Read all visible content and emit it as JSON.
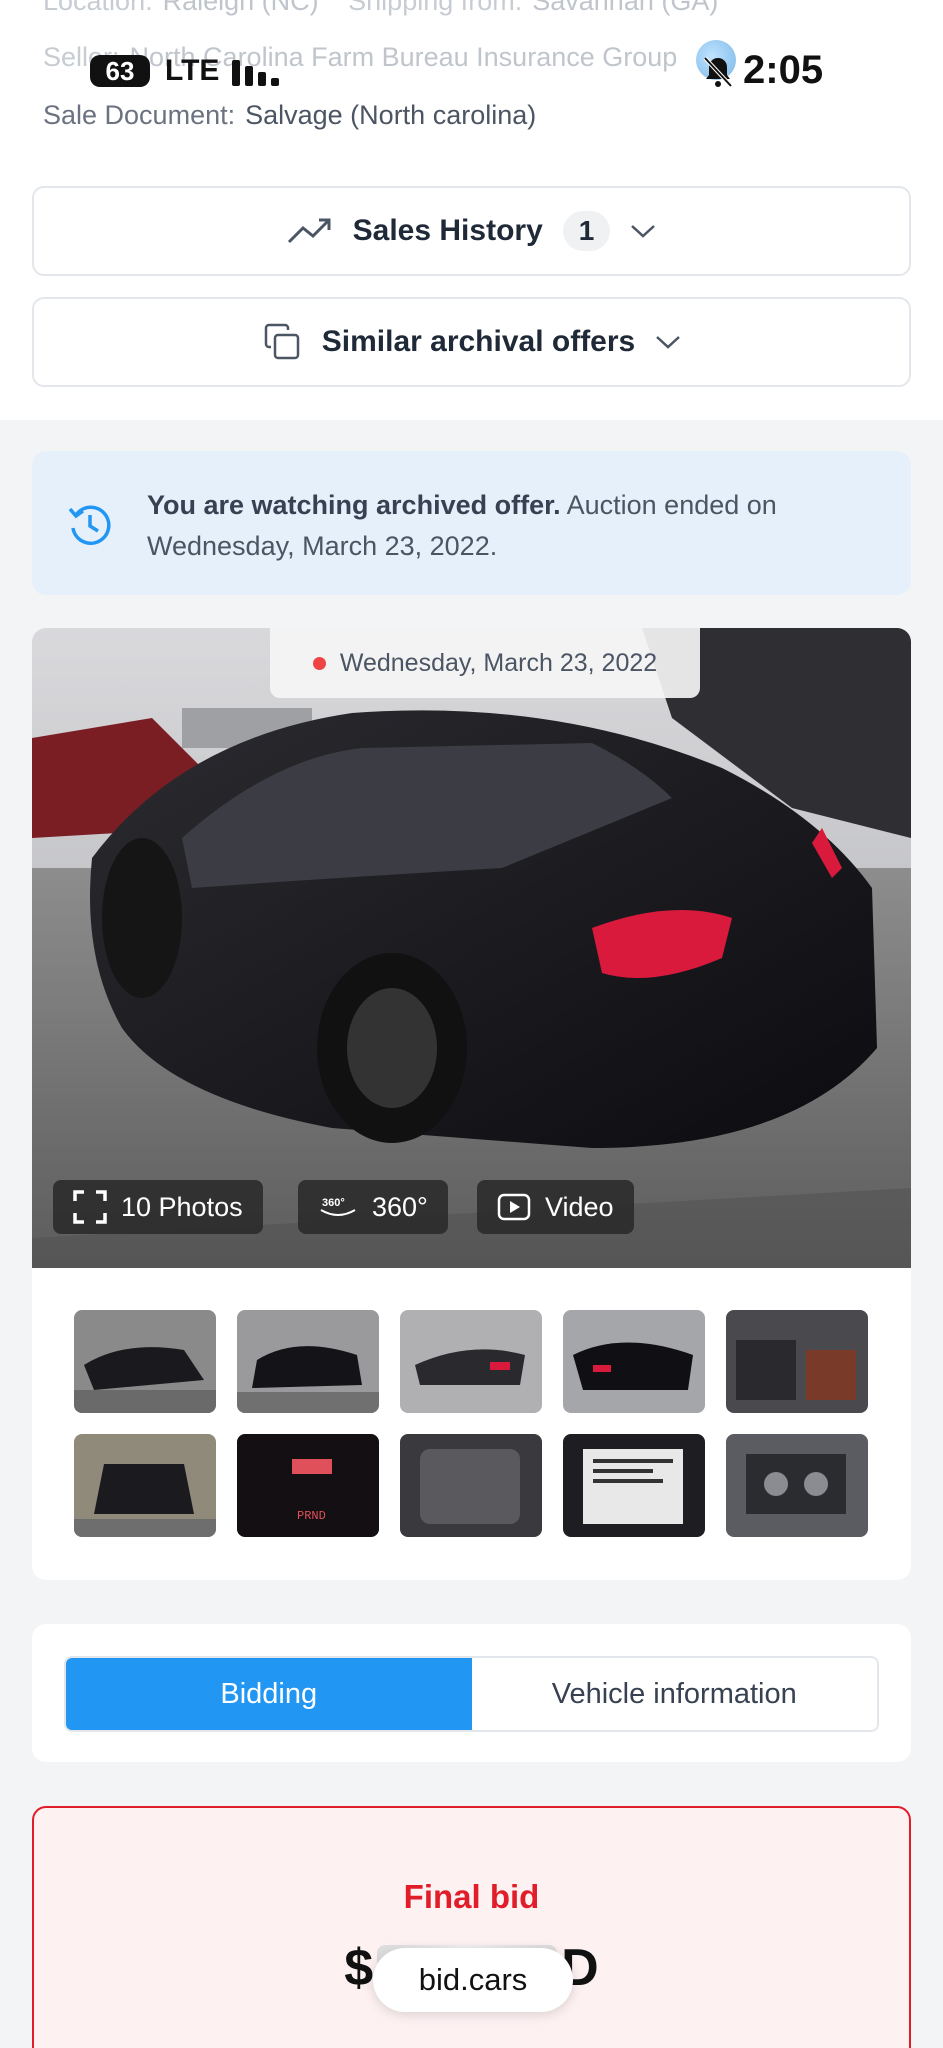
{
  "status_bar": {
    "badge": "63",
    "network": "LTE",
    "time": "2:05"
  },
  "meta": {
    "location_label": "Location:",
    "location_value": "Raleigh (NC)",
    "shipping_label": "Shipping from:",
    "shipping_value": "Savannah (GA)",
    "seller_label": "Seller:",
    "seller_value": "North Carolina Farm Bureau Insurance Group",
    "sale_doc_label": "Sale Document:",
    "sale_doc_value": "Salvage (North carolina)"
  },
  "sections": {
    "sales_history": {
      "label": "Sales History",
      "count": "1"
    },
    "similar": {
      "label": "Similar archival offers"
    }
  },
  "archive_notice": {
    "bold": "You are watching archived offer.",
    "rest": " Auction ended on Wednesday, March 23, 2022."
  },
  "photo": {
    "date": "Wednesday, March 23, 2022",
    "photos_btn": "10 Photos",
    "view360_btn": "360°",
    "video_btn": "Video"
  },
  "tabs": {
    "bidding": "Bidding",
    "vehicle_info": "Vehicle information"
  },
  "final_bid": {
    "label": "Final bid",
    "currency_prefix": "$",
    "currency_suffix": "D"
  },
  "watermark": "bid.cars",
  "colors": {
    "accent": "#2196f3",
    "final_red": "#e11d2a",
    "banner_bg": "#e6f0fb"
  }
}
